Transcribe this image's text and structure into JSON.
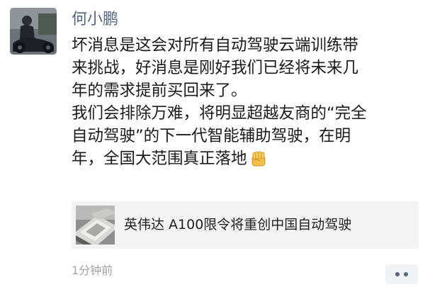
{
  "post": {
    "author": "何小鹏",
    "text_lines": [
      "坏消息是这会对所有自动驾驶云端训练带",
      "来挑战，好消息是刚好我们已经将未来几",
      "年的需求提前买回来了。",
      "我们会排除万难，将明显超越友商的“完全",
      "自动驾驶”的下一代智能辅助驾驶，在明",
      "年，全国大范围真正落地"
    ],
    "emoji_icon": "raised-fist-emoji",
    "link": {
      "title": "英伟达 A100限令将重创中国自动驾驶",
      "thumbnail_icon": "chip-thumbnail"
    },
    "timestamp": "1分钟前"
  },
  "actions": {
    "more_icon": "more-dots-icon"
  },
  "colors": {
    "author_name": "#56657d",
    "body_text": "#1a1a1a",
    "link_card_bg": "#f3f3f3",
    "timestamp": "#a3a3a3",
    "more_button_bg": "#f1f2f5"
  }
}
